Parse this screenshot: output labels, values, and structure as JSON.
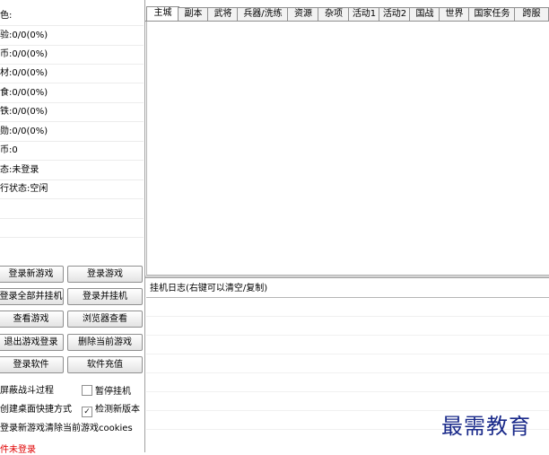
{
  "status_rows": [
    "色:",
    "验:0/0(0%)",
    "币:0/0(0%)",
    "材:0/0(0%)",
    "食:0/0(0%)",
    "铁:0/0(0%)",
    "勋:0/0(0%)",
    "币:0",
    "态:未登录",
    "行状态:空闲",
    "",
    ""
  ],
  "buttons": {
    "login_new_game": "登录新游戏",
    "login_game": "登录游戏",
    "login_all_and_hang": "登录全部并挂机",
    "login_and_hang": "登录并挂机",
    "view_game": "查看游戏",
    "browser_view": "浏览器查看",
    "logout_game": "退出游戏登录",
    "delete_current_game": "删除当前游戏",
    "login_software": "登录软件",
    "software_recharge": "软件充值"
  },
  "options": {
    "hide_battle": {
      "label": "屏蔽战斗过程",
      "checked": false
    },
    "pause_hang": {
      "label": "暂停挂机",
      "checked": false
    },
    "create_shortcut": {
      "label": "创建桌面快捷方式",
      "checked": false
    },
    "check_new_version": {
      "label": "检测新版本",
      "checked": true
    },
    "clear_cookies": {
      "label": "登录新游戏清除当前游戏cookies",
      "checked": false
    }
  },
  "software_status": "件未登录",
  "tabs": [
    "主城",
    "副本",
    "武将",
    "兵器/洗练",
    "资源",
    "杂项",
    "活动1",
    "活动2",
    "国战",
    "世界",
    "国家任务",
    "跨服"
  ],
  "active_tab": "主城",
  "log_header": "挂机日志(右键可以清空/复制)",
  "watermark": "最需教育"
}
